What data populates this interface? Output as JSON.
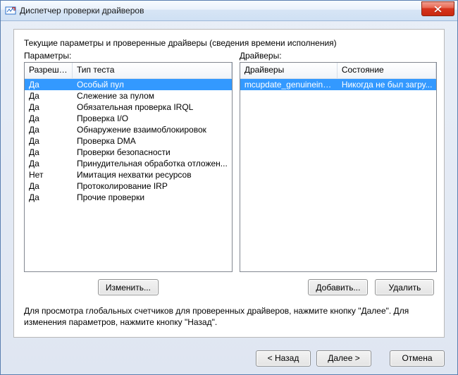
{
  "window": {
    "title": "Диспетчер проверки драйверов"
  },
  "heading": "Текущие параметры и проверенные драйверы (сведения времени исполнения)",
  "panels": {
    "params": {
      "label": "Параметры:",
      "columns": {
        "allowed": "Разреше...",
        "test": "Тип теста"
      },
      "rows": [
        {
          "allowed": "Да",
          "test": "Особый пул",
          "selected": true
        },
        {
          "allowed": "Да",
          "test": "Слежение за пулом"
        },
        {
          "allowed": "Да",
          "test": "Обязательная проверка IRQL"
        },
        {
          "allowed": "Да",
          "test": "Проверка I/O"
        },
        {
          "allowed": "Да",
          "test": "Обнаружение взаимоблокировок"
        },
        {
          "allowed": "Да",
          "test": "Проверка DMA"
        },
        {
          "allowed": "Да",
          "test": "Проверки безопасности"
        },
        {
          "allowed": "Да",
          "test": "Принудительная обработка отложен..."
        },
        {
          "allowed": "Нет",
          "test": "Имитация нехватки ресурсов"
        },
        {
          "allowed": "Да",
          "test": "Протоколирование IRP"
        },
        {
          "allowed": "Да",
          "test": "Прочие проверки"
        }
      ]
    },
    "drivers": {
      "label": "Драйверы:",
      "columns": {
        "driver": "Драйверы",
        "state": "Состояние"
      },
      "rows": [
        {
          "driver": "mcupdate_genuineintel.dll",
          "state": "Никогда не был загру...",
          "selected": true
        }
      ]
    }
  },
  "buttons": {
    "change": "Изменить...",
    "add": "Добавить...",
    "remove": "Удалить"
  },
  "hint": "Для просмотра глобальных счетчиков для проверенных драйверов, нажмите кнопку \"Далее\". Для изменения параметров, нажмите кнопку \"Назад\".",
  "footer": {
    "back": "< Назад",
    "next": "Далее >",
    "cancel": "Отмена"
  }
}
